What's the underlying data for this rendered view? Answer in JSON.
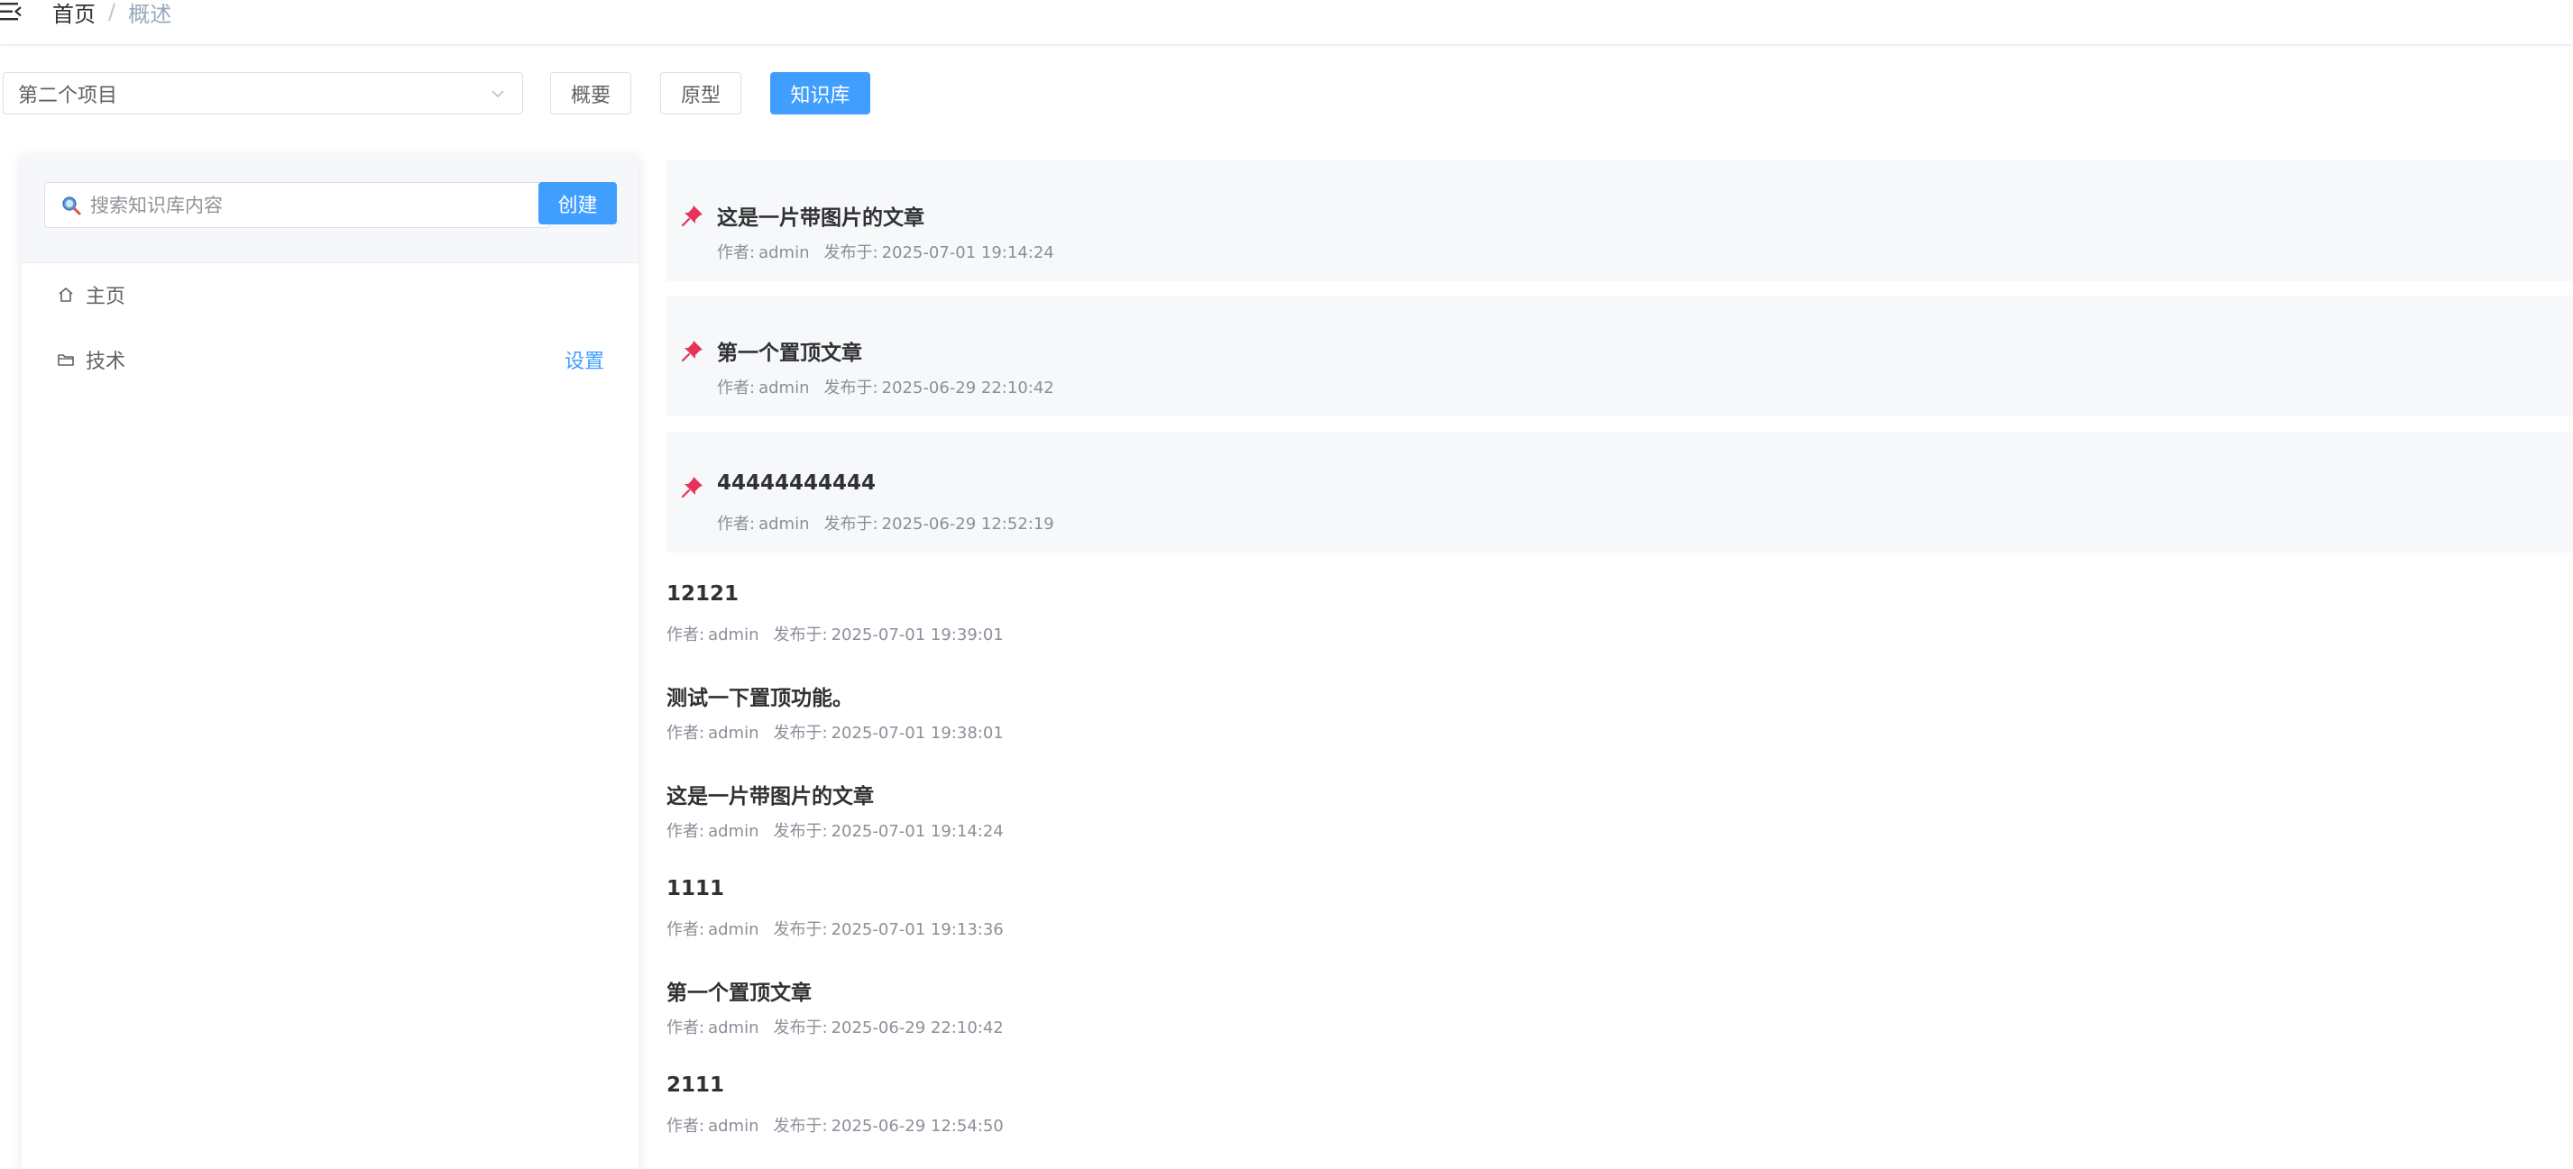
{
  "breadcrumb": {
    "home": "首页",
    "separator": "/",
    "current": "概述"
  },
  "project_select": {
    "value": "第二个项目"
  },
  "tabs": {
    "overview": "概要",
    "prototype": "原型",
    "knowledge_base": "知识库"
  },
  "sidebar": {
    "search_placeholder": "搜索知识库内容",
    "create_label": "创建",
    "items": [
      {
        "label": "主页",
        "icon": "home-icon"
      },
      {
        "label": "技术",
        "icon": "folder-icon",
        "action": "设置"
      }
    ]
  },
  "meta_labels": {
    "author": "作者:",
    "published": "发布于:"
  },
  "pinned_articles": [
    {
      "title": "这是一片带图片的文章",
      "author": "admin",
      "date": "2025-07-01 19:14:24"
    },
    {
      "title": "第一个置顶文章",
      "author": "admin",
      "date": "2025-06-29 22:10:42"
    },
    {
      "title": "44444444444",
      "author": "admin",
      "date": "2025-06-29 12:52:19"
    }
  ],
  "articles": [
    {
      "title": "12121",
      "author": "admin",
      "date": "2025-07-01 19:39:01"
    },
    {
      "title": "测试一下置顶功能。",
      "author": "admin",
      "date": "2025-07-01 19:38:01"
    },
    {
      "title": "这是一片带图片的文章",
      "author": "admin",
      "date": "2025-07-01 19:14:24"
    },
    {
      "title": "1111",
      "author": "admin",
      "date": "2025-07-01 19:13:36"
    },
    {
      "title": "第一个置顶文章",
      "author": "admin",
      "date": "2025-06-29 22:10:42"
    },
    {
      "title": "2111",
      "author": "admin",
      "date": "2025-06-29 12:54:50"
    }
  ],
  "colors": {
    "accent": "#409eff",
    "pin": "#e6335a",
    "pinned_bg": "#f7f8f9"
  }
}
